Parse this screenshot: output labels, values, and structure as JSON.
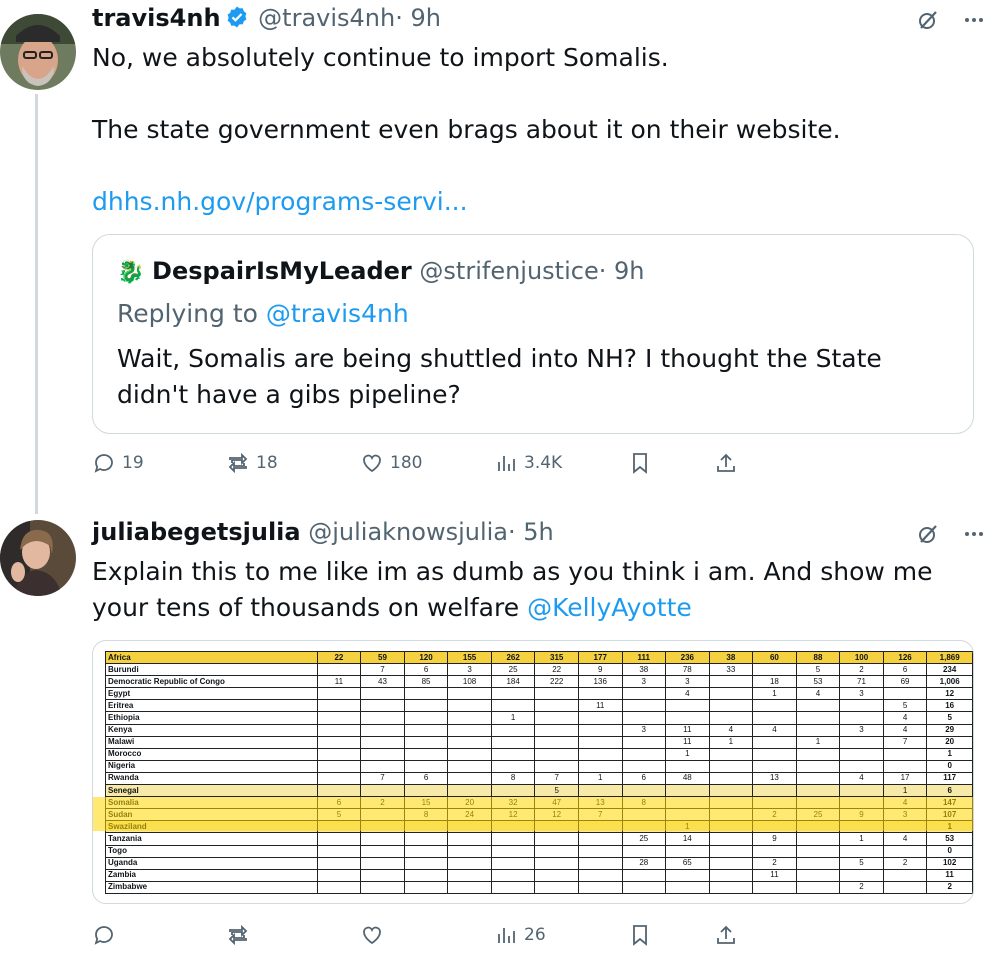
{
  "tweet1": {
    "display_name": "travis4nh",
    "handle": "@travis4nh",
    "time": "· 9h",
    "verified": true,
    "text_line1": "No, we absolutely continue to import Somalis.",
    "text_line2": "The state government even brags about it on their website.",
    "link": "dhhs.nh.gov/programs-servi...",
    "quote": {
      "emoji": "🐉",
      "display_name": "DespairIsMyLeader",
      "handle": "@strifenjustice",
      "time": "· 9h",
      "replying_prefix": "Replying to",
      "replying_to": "@travis4nh",
      "text": "Wait, Somalis are being shuttled into NH?  I thought the State didn't have a gibs pipeline?"
    },
    "stats": {
      "replies": "19",
      "reposts": "18",
      "likes": "180",
      "views": "3.4K"
    }
  },
  "tweet2": {
    "display_name": "juliabegetsjulia",
    "handle": "@juliaknowsjulia",
    "time": "· 5h",
    "text": "Explain this to me like im as dumb as you think i am. And show me your tens of thousands on welfare ",
    "mention": "@KellyAyotte",
    "stats": {
      "replies": "",
      "reposts": "",
      "likes": "",
      "views": "26"
    }
  },
  "icons": {
    "verified": "verified-badge-icon",
    "grok": "grok-icon",
    "more": "more-icon",
    "reply": "reply-icon",
    "repost": "repost-icon",
    "like": "like-icon",
    "views": "views-icon",
    "bookmark": "bookmark-icon",
    "share": "share-icon"
  },
  "colors": {
    "link": "#1d9bf0",
    "secondary": "#536471",
    "border": "#cfd9de",
    "table_header": "#f5d03f",
    "highlight": "#ffd700"
  },
  "chart_data": {
    "type": "table",
    "header": [
      "Africa",
      "22",
      "59",
      "120",
      "155",
      "262",
      "315",
      "177",
      "111",
      "236",
      "38",
      "60",
      "88",
      "100",
      "126",
      "1,869"
    ],
    "rows": [
      [
        "Burundi",
        "",
        "7",
        "6",
        "3",
        "25",
        "22",
        "9",
        "38",
        "78",
        "33",
        "",
        "5",
        "2",
        "6",
        "234"
      ],
      [
        "Democratic Republic of Congo",
        "11",
        "43",
        "85",
        "108",
        "184",
        "222",
        "136",
        "3",
        "3",
        "",
        "18",
        "53",
        "71",
        "69",
        "1,006"
      ],
      [
        "Egypt",
        "",
        "",
        "",
        "",
        "",
        "",
        "",
        "",
        "4",
        "",
        "1",
        "4",
        "3",
        "",
        "12"
      ],
      [
        "Eritrea",
        "",
        "",
        "",
        "",
        "",
        "",
        "11",
        "",
        "",
        "",
        "",
        "",
        "",
        "5",
        "16"
      ],
      [
        "Ethiopia",
        "",
        "",
        "",
        "",
        "1",
        "",
        "",
        "",
        "",
        "",
        "",
        "",
        "",
        "4",
        "5"
      ],
      [
        "Kenya",
        "",
        "",
        "",
        "",
        "",
        "",
        "",
        "3",
        "11",
        "4",
        "4",
        "",
        "3",
        "4",
        "29"
      ],
      [
        "Malawi",
        "",
        "",
        "",
        "",
        "",
        "",
        "",
        "",
        "11",
        "1",
        "",
        "1",
        "",
        "7",
        "20"
      ],
      [
        "Morocco",
        "",
        "",
        "",
        "",
        "",
        "",
        "",
        "",
        "1",
        "",
        "",
        "",
        "",
        "",
        "1"
      ],
      [
        "Nigeria",
        "",
        "",
        "",
        "",
        "",
        "",
        "",
        "",
        "",
        "",
        "",
        "",
        "",
        "",
        "0"
      ],
      [
        "Rwanda",
        "",
        "7",
        "6",
        "",
        "8",
        "7",
        "1",
        "6",
        "48",
        "",
        "13",
        "",
        "4",
        "17",
        "117"
      ],
      [
        "Senegal",
        "",
        "",
        "",
        "",
        "",
        "5",
        "",
        "",
        "",
        "",
        "",
        "",
        "",
        "1",
        "6"
      ],
      [
        "Somalia",
        "6",
        "2",
        "15",
        "20",
        "32",
        "47",
        "13",
        "8",
        "",
        "",
        "",
        "",
        "",
        "4",
        "147"
      ],
      [
        "Sudan",
        "5",
        "",
        "8",
        "24",
        "12",
        "12",
        "7",
        "",
        "",
        "",
        "2",
        "25",
        "9",
        "3",
        "107"
      ],
      [
        "Swaziland",
        "",
        "",
        "",
        "",
        "",
        "",
        "",
        "",
        "1",
        "",
        "",
        "",
        "",
        "",
        "1"
      ],
      [
        "Tanzania",
        "",
        "",
        "",
        "",
        "",
        "",
        "",
        "25",
        "14",
        "",
        "9",
        "",
        "1",
        "4",
        "53"
      ],
      [
        "Togo",
        "",
        "",
        "",
        "",
        "",
        "",
        "",
        "",
        "",
        "",
        "",
        "",
        "",
        "",
        "0"
      ],
      [
        "Uganda",
        "",
        "",
        "",
        "",
        "",
        "",
        "",
        "28",
        "65",
        "",
        "2",
        "",
        "5",
        "2",
        "102"
      ],
      [
        "Zambia",
        "",
        "",
        "",
        "",
        "",
        "",
        "",
        "",
        "",
        "",
        "11",
        "",
        "",
        "",
        "11"
      ],
      [
        "Zimbabwe",
        "",
        "",
        "",
        "",
        "",
        "",
        "",
        "",
        "",
        "",
        "",
        "",
        "2",
        "",
        "2"
      ]
    ],
    "highlighted_rows": [
      "Senegal",
      "Somalia",
      "Sudan",
      "Swaziland"
    ]
  }
}
